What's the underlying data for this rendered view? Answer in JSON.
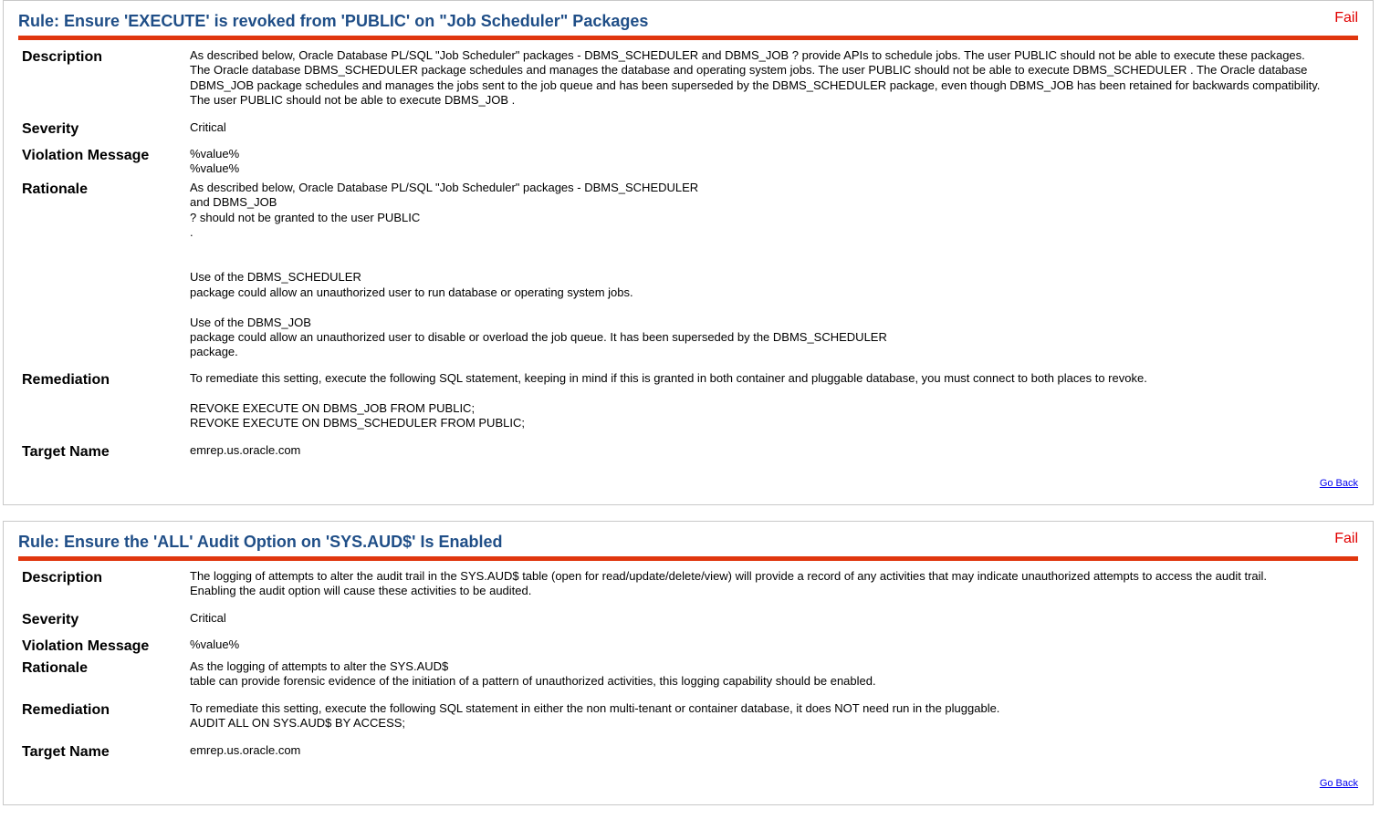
{
  "labels": {
    "description": "Description",
    "severity": "Severity",
    "violation_message": "Violation Message",
    "rationale": "Rationale",
    "remediation": "Remediation",
    "target_name": "Target Name",
    "go_back": "Go Back"
  },
  "colors": {
    "title": "#1f4e87",
    "status_fail": "#e00000",
    "header_rule": "#e0360e",
    "link": "#0000ee"
  },
  "rules": [
    {
      "title": "Rule: Ensure 'EXECUTE' is revoked from 'PUBLIC' on \"Job Scheduler\" Packages",
      "status": "Fail",
      "description": "As described below, Oracle Database PL/SQL \"Job Scheduler\" packages - DBMS_SCHEDULER and DBMS_JOB ? provide APIs to schedule jobs. The user PUBLIC should not be able to execute these packages.\nThe Oracle database DBMS_SCHEDULER package schedules and manages the database and operating system jobs. The user PUBLIC should not be able to execute DBMS_SCHEDULER . The Oracle database\nDBMS_JOB package schedules and manages the jobs sent to the job queue and has been superseded by the DBMS_SCHEDULER package, even though DBMS_JOB has been retained for backwards compatibility.\nThe user PUBLIC should not be able to execute DBMS_JOB .",
      "severity": "Critical",
      "violation_message": "%value%\n%value%",
      "rationale": "As described below, Oracle Database PL/SQL \"Job Scheduler\" packages - DBMS_SCHEDULER\nand DBMS_JOB\n? should not be granted to the user PUBLIC\n.\n\n\nUse of the DBMS_SCHEDULER\npackage could allow an unauthorized user to run database or operating system jobs.\n\nUse of the DBMS_JOB\npackage could allow an unauthorized user to disable or overload the job queue. It has been superseded by the DBMS_SCHEDULER\npackage.",
      "remediation": "To remediate this setting, execute the following SQL statement, keeping in mind if this is granted in both container and pluggable database, you must connect to both places to revoke.\n\nREVOKE EXECUTE ON DBMS_JOB FROM PUBLIC;\nREVOKE EXECUTE ON DBMS_SCHEDULER FROM PUBLIC;",
      "target_name": "emrep.us.oracle.com"
    },
    {
      "title": "Rule: Ensure the 'ALL' Audit Option on 'SYS.AUD$' Is Enabled",
      "status": "Fail",
      "description": "The logging of attempts to alter the audit trail in the SYS.AUD$ table (open for read/update/delete/view) will provide a record of any activities that may indicate unauthorized attempts to access the audit trail.\nEnabling the audit option will cause these activities to be audited.",
      "severity": "Critical",
      "violation_message": "%value%",
      "rationale": "As the logging of attempts to alter the SYS.AUD$\ntable can provide forensic evidence of the initiation of a pattern of unauthorized activities, this logging capability should be enabled.",
      "remediation": "To remediate this setting, execute the following SQL statement in either the non multi-tenant or container database, it does NOT need run in the pluggable.\nAUDIT ALL ON SYS.AUD$ BY ACCESS;",
      "target_name": "emrep.us.oracle.com"
    }
  ]
}
